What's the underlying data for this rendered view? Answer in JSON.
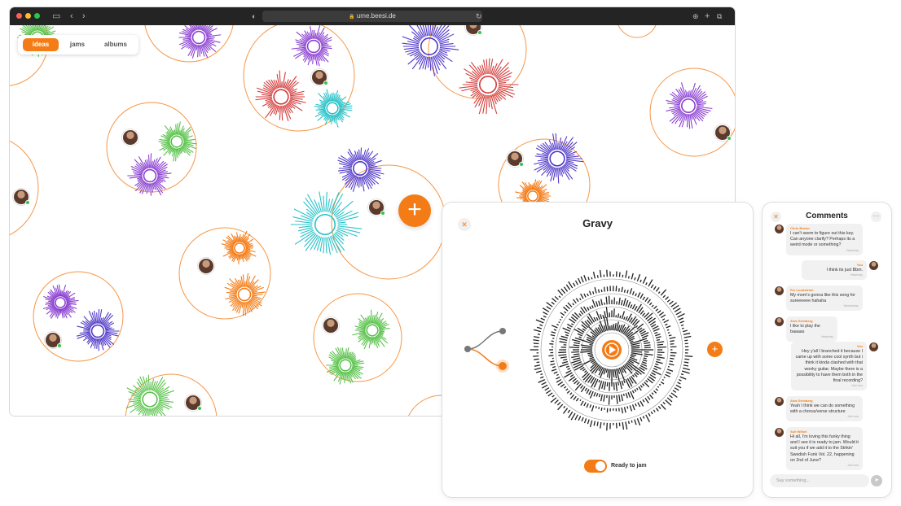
{
  "browser": {
    "url": "ume.beesi.de"
  },
  "tabs": [
    {
      "label": "ideas",
      "active": true
    },
    {
      "label": "jams",
      "active": false
    },
    {
      "label": "albums",
      "active": false
    }
  ],
  "colors": {
    "accent": "#f47c16",
    "online": "#38c24b",
    "purple": "#8a3fd1",
    "indigo": "#5038c8",
    "red": "#d33a3a",
    "teal": "#28c2c8",
    "green": "#58c24a"
  },
  "song": {
    "title": "Gravy",
    "toggle_label": "Ready to jam",
    "toggle_on": true
  },
  "comments": {
    "title": "Comments",
    "input_placeholder": "Say something...",
    "messages": [
      {
        "name": "Chris Brown",
        "text": "I can't seem to figure out this key. Can anyone clarify? Perhaps its a weird mode or something?",
        "time": "Yesterday",
        "side": "left"
      },
      {
        "name": "You",
        "text": "I think its just Bbm.",
        "time": "Yesterday",
        "side": "right"
      },
      {
        "name": "Per Lundström",
        "text": "My mom's gonna like this song for sureeeeee hahaha",
        "time": "Wednesday",
        "side": "left"
      },
      {
        "name": "Alva Grimberg",
        "text": "I like to play the baaaas",
        "time": "Yesterday",
        "side": "left"
      },
      {
        "name": "You",
        "text": "Hey y'all I branched it because I came up with some cool synth but i think it kinda clashed with that wonky guitar. Maybe there is a possibility to have them both in the final recording?",
        "time": "Just now",
        "side": "right"
      },
      {
        "name": "Alva Grimberg",
        "text": "Yeah I think we can do something with a chorus/verse structure",
        "time": "Just now",
        "side": "left"
      },
      {
        "name": "Sulf Wilhel",
        "text": "Hi all, I'm loving this funky thing and I see it is ready to jam. Would it suit you if we add it to the Strikin' Swedish Funk Vol. 22, happening on 2nd of June?",
        "time": "Just now",
        "side": "left"
      }
    ]
  }
}
